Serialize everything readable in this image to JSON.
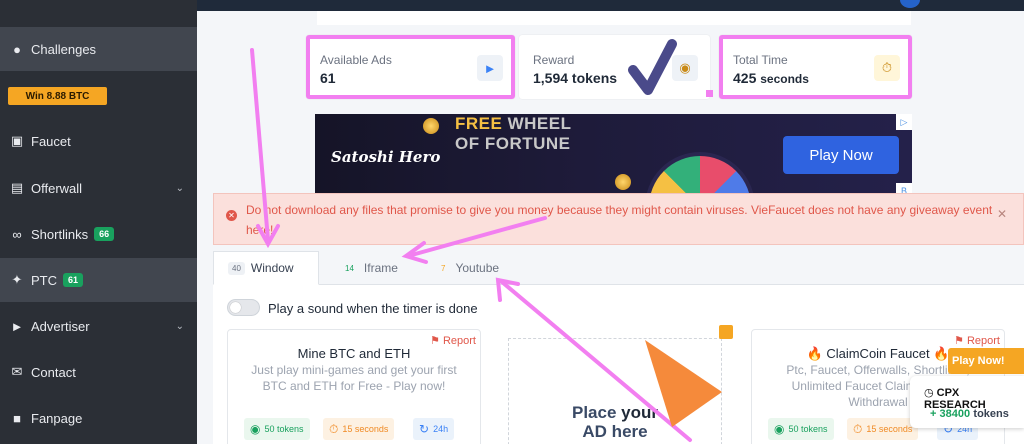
{
  "sidebar": {
    "items": [
      {
        "label": "Challenges",
        "icon": "fire-icon"
      },
      {
        "label": "Faucet",
        "icon": "gift-icon"
      },
      {
        "label": "Offerwall",
        "icon": "clipboard-icon"
      },
      {
        "label": "Shortlinks",
        "icon": "link-icon",
        "badge": "66"
      },
      {
        "label": "PTC",
        "icon": "cursor-click-icon",
        "badge": "61"
      },
      {
        "label": "Advertiser",
        "icon": "megaphone-icon"
      },
      {
        "label": "Contact",
        "icon": "envelope-icon"
      },
      {
        "label": "Fanpage",
        "icon": "facebook-icon"
      }
    ],
    "win_button": "Win 8.88 BTC"
  },
  "stats": {
    "available_ads": {
      "label": "Available Ads",
      "value": "61",
      "icon": "megaphone-icon"
    },
    "reward": {
      "label": "Reward",
      "value": "1,594 tokens",
      "icon": "coins-icon"
    },
    "total_time": {
      "label": "Total Time",
      "value": "425",
      "unit": "seconds",
      "icon": "stopwatch-icon"
    }
  },
  "banner": {
    "brand": "Satoshi Hero",
    "line1_free": "FREE",
    "line1_rest": " WHEEL",
    "line2": "OF FORTUNE",
    "cta": "Play Now"
  },
  "alert": {
    "message": "Do not download any files that promise to give you money because they might contain viruses. VieFaucet does not have any giveaway event here!"
  },
  "tabs": [
    {
      "count": "40",
      "label": "Window",
      "active": true
    },
    {
      "count": "14",
      "label": "Iframe",
      "active": false
    },
    {
      "count": "7",
      "label": "Youtube",
      "active": false
    }
  ],
  "toggle": {
    "label": "Play a sound when the timer is done",
    "on": false
  },
  "cards": [
    {
      "title": "Mine BTC and ETH",
      "desc": "Just play mini-games and get your first BTC and ETH for Free - Play now!",
      "report": "Report",
      "tokens": "50 tokens",
      "time": "15 seconds",
      "period": "24h"
    },
    {
      "title": "ClaimCoin Faucet",
      "desc": "Ptc, Faucet, Offerwalls, Shortlinks, Unlimited Faucet Claims, Instant Withdrawal",
      "report": "Report",
      "tokens": "50 tokens",
      "time": "15 seconds",
      "period": "24h"
    }
  ],
  "ad_placeholder": {
    "line1_a": "Place ",
    "line1_b": "your",
    "line2": "AD here"
  },
  "cpx": {
    "play_now": "Play Now!",
    "brand": "CPX RESEARCH",
    "gain": "+ 38400",
    "gain_unit": "tokens"
  },
  "colors": {
    "sidebar_bg": "#2b2f36",
    "highlight_pink": "#f27ff0",
    "success_green": "#19a15e",
    "accent_orange": "#f5a623",
    "alert_red": "#e0574a",
    "primary_blue": "#2f63e0"
  }
}
